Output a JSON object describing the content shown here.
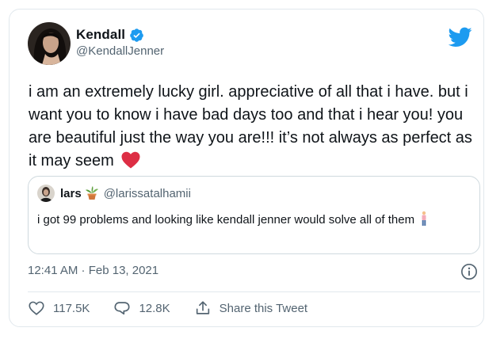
{
  "author": {
    "name": "Kendall",
    "handle": "@KendallJenner",
    "verified_icon": "verified-badge-icon"
  },
  "tweet": {
    "text": "i am an extremely lucky girl. appreciative of all that i have. but i want you to know i have bad days too and that i hear you! you are beautiful just the way you are!!! it’s not always as perfect as it may seem",
    "emoji": "red-heart-emoji"
  },
  "quoted": {
    "name": "lars",
    "name_emoji": "potted-plant-emoji",
    "handle": "@larissatalhamii",
    "text": "i got 99 problems and looking like kendall jenner would solve all of them",
    "text_emoji": "standing-person-emoji"
  },
  "meta": {
    "timestamp": "12:41 AM · Feb 13, 2021"
  },
  "actions": {
    "likes": "117.5K",
    "replies": "12.8K",
    "share_label": "Share this Tweet"
  },
  "colors": {
    "twitter_blue": "#1d9bf0",
    "heart_red": "#dd2e44",
    "muted": "#536471"
  }
}
